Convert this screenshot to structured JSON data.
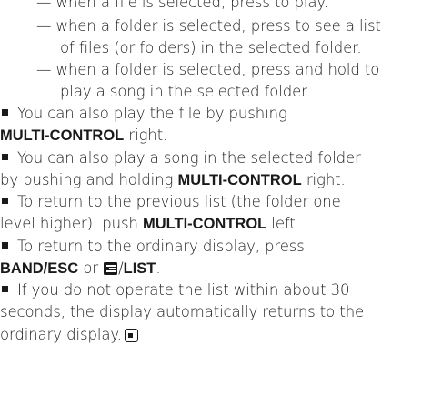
{
  "dash_items": [
    {
      "line1": "— when a file is selected, press to play."
    },
    {
      "line1": "— when a folder is selected, press to see a list",
      "line2": "of files (or folders) in the selected folder."
    },
    {
      "line1": "— when a folder is selected, press and hold to",
      "line2": "play a song in the selected folder."
    }
  ],
  "notes": [
    {
      "line1": "You can also play the file by pushing",
      "key": "MULTI-CONTROL",
      "tail": " right."
    },
    {
      "line1": "You can also play a song in the selected folder",
      "line2_pre": "by pushing and holding ",
      "key": "MULTI-CONTROL",
      "tail": " right."
    },
    {
      "line1": "To return to the previous list (the folder one",
      "line2_pre": "level higher), push ",
      "key": "MULTI-CONTROL",
      "tail": " left."
    },
    {
      "line1": "To return to the ordinary display, press",
      "key1": "BAND/ESC",
      "or": " or ",
      "icon": "list-icon",
      "slash": "/",
      "key2": "LIST",
      "tail": "."
    },
    {
      "line1": "If you do not operate the list within about 30",
      "line2": "seconds, the display automatically returns to the",
      "line3": "ordinary display.",
      "end_icon": "end-of-section-icon"
    }
  ]
}
